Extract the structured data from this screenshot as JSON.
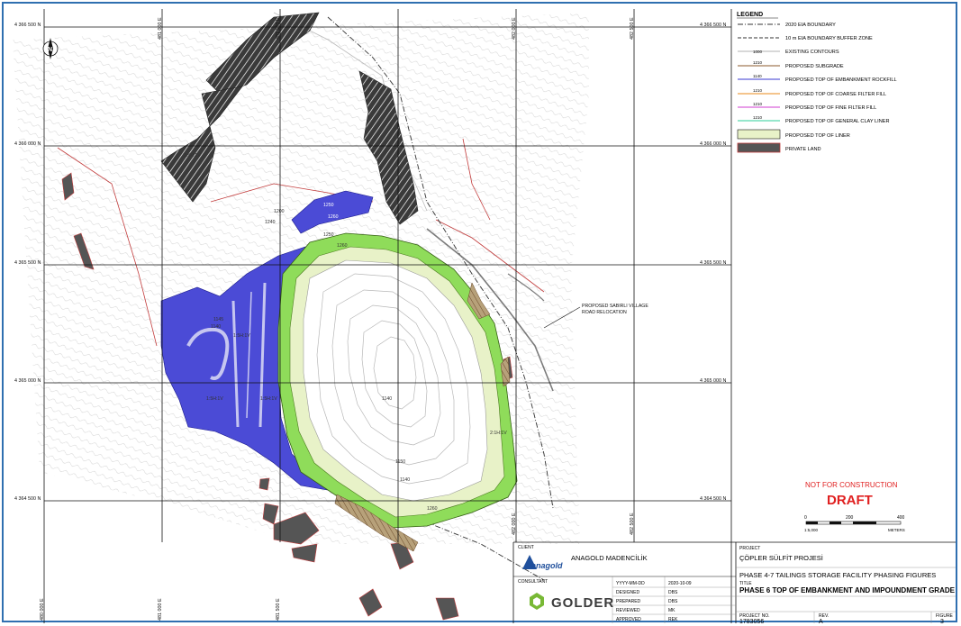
{
  "legend": {
    "title": "LEGEND",
    "items": [
      {
        "sample": "",
        "label": "2020 EIA BOUNDARY"
      },
      {
        "sample": "",
        "label": "10 m EIA BOUNDARY BUFFER ZONE"
      },
      {
        "sample": "1000",
        "label": "EXISTING CONTOURS"
      },
      {
        "sample": "1210",
        "label": "PROPOSED SUBGRADE"
      },
      {
        "sample": "1140",
        "label": "PROPOSED TOP OF EMBANKMENT ROCKFILL"
      },
      {
        "sample": "1210",
        "label": "PROPOSED TOP OF COARSE FILTER FILL"
      },
      {
        "sample": "1210",
        "label": "PROPOSED TOP OF FINE FILTER FILL"
      },
      {
        "sample": "1210",
        "label": "PROPOSED TOP OF GENERAL CLAY LINER"
      },
      {
        "sample": "",
        "label": "PROPOSED TOP OF LINER"
      },
      {
        "sample": "",
        "label": "PRIVATE LAND"
      }
    ]
  },
  "colors": {
    "frame": "#2f6fb0",
    "rockfill": "#4b4bd6",
    "liner": "#e8f2c8",
    "clay": "#8fdc5a",
    "private": "#555555",
    "draft": "#e02020",
    "golder_green": "#78b935",
    "golder_dark": "#3c3c3c"
  },
  "grid": {
    "northings": [
      "4 366 500  N",
      "4 366 000  N",
      "4 365 500  N",
      "4 365 000  N",
      "4 364 500  N"
    ],
    "eastings": [
      "481 000  E",
      "481 500  E",
      "482 000  E",
      "482 500  E"
    ],
    "eastings_bottom": [
      "480 000  E",
      "481 000  E",
      "481 500  E",
      "482 000  E",
      "482 500  E"
    ]
  },
  "annotations": {
    "road": "PROPOSED SABIRLI VILLAGE\nROAD RELOCATION",
    "not_for_construction": "NOT FOR CONSTRUCTION",
    "draft": "DRAFT"
  },
  "scale_bar": {
    "ticks": [
      "0",
      "200",
      "400"
    ],
    "ratio": "1:5,000",
    "unit": "METERS"
  },
  "title_block": {
    "client_label": "CLIENT",
    "client_name": "ANAGOLD MADENCİLİK",
    "client_logo": "anagold",
    "consultant_label": "CONSULTANT",
    "consultant_logo": "GOLDER",
    "fields": [
      {
        "label": "YYYY-MM-DD",
        "value": "2020-10-09"
      },
      {
        "label": "DESIGNED",
        "value": "DBS"
      },
      {
        "label": "PREPARED",
        "value": "DBS"
      },
      {
        "label": "REVIEWED",
        "value": "MK"
      },
      {
        "label": "APPROVED",
        "value": "REK"
      }
    ],
    "project_label": "PROJECT",
    "project_name": "ÇÖPLER SÜLFİT PROJESİ",
    "project_phase": "PHASE 4-7 TAILINGS STORAGE FACILITY PHASING FIGURES",
    "title_label": "TITLE",
    "title": "PHASE 6 TOP OF EMBANKMENT AND IMPOUNDMENT GRADE",
    "project_no_label": "PROJECT NO.",
    "project_no": "1783056",
    "rev_label": "REV.",
    "rev": "A",
    "figure_label": "FIGURE",
    "figure": "3"
  },
  "north_arrow": "N"
}
